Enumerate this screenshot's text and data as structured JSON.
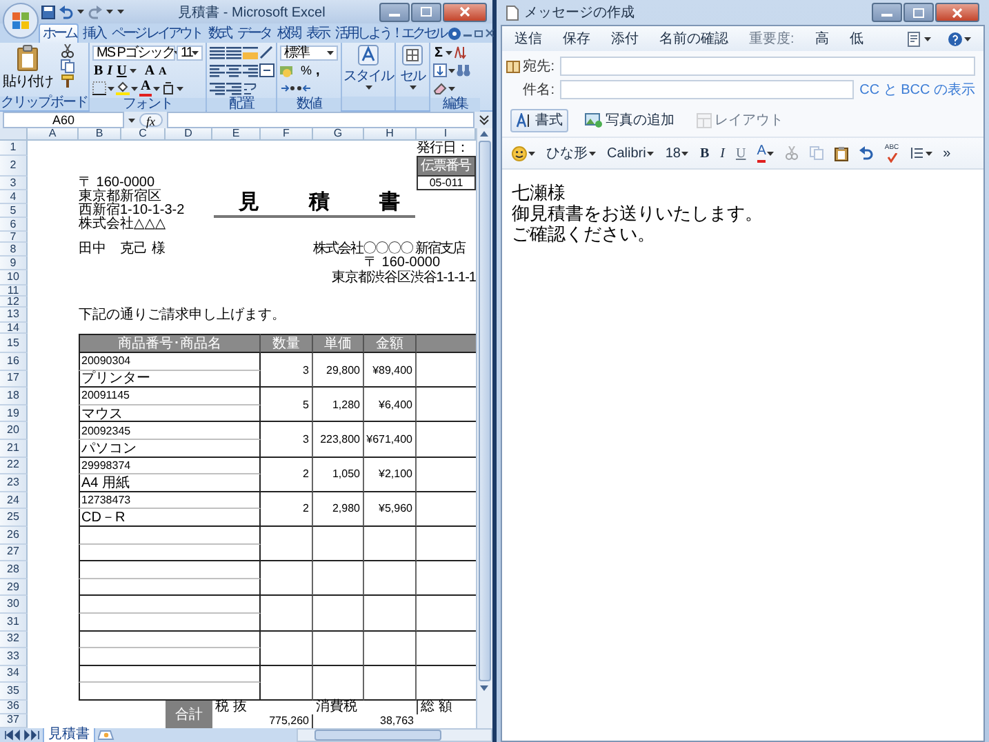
{
  "excel": {
    "title": "見積書 - Microsoft Excel",
    "tabs": [
      {
        "label": "ホーム",
        "selected": true
      },
      {
        "label": "挿入",
        "selected": false
      },
      {
        "label": "ページ レイアウト",
        "selected": false
      },
      {
        "label": "数式",
        "selected": false
      },
      {
        "label": "データ",
        "selected": false
      },
      {
        "label": "校閲",
        "selected": false
      },
      {
        "label": "表示",
        "selected": false
      },
      {
        "label": "活用しよう！エクセル",
        "selected": false
      }
    ],
    "ribbon": {
      "clipboard": {
        "label": "クリップボード",
        "paste": "貼り付け"
      },
      "font": {
        "label": "フォント",
        "font_name": "MS Pゴシック",
        "font_size": "11",
        "grow": "A",
        "shrink": "A",
        "bold": "B",
        "italic": "I",
        "underline": "U",
        "font_color": "A"
      },
      "alignment": {
        "label": "配置"
      },
      "number": {
        "label": "数値",
        "format": "標準",
        "percent": "%",
        "comma": ","
      },
      "styles": {
        "button": "スタイル"
      },
      "cells": {
        "button": "セル"
      },
      "editing": {
        "label": "編集",
        "sum": "Σ"
      }
    },
    "name_box": "A60",
    "fx": "fx",
    "columns": [
      "A",
      "B",
      "C",
      "D",
      "E",
      "F",
      "G",
      "H",
      "I"
    ],
    "rows": [
      "1",
      "2",
      "3",
      "4",
      "5",
      "6",
      "7",
      "8",
      "9",
      "10",
      "11",
      "12",
      "13",
      "14",
      "15",
      "16",
      "17",
      "18",
      "19",
      "20",
      "21",
      "22",
      "23",
      "24",
      "25",
      "26",
      "27",
      "28",
      "29",
      "30",
      "31",
      "32",
      "33",
      "34",
      "35",
      "36",
      "37"
    ],
    "sheet": {
      "issue_date_label": "発行日：",
      "slip_number_label": "伝票番号",
      "slip_number": "05-011",
      "sender": [
        "〒 160-0000",
        "東京都新宿区",
        "西新宿1-10-1-3-2",
        "株式会社△△△"
      ],
      "title": "見積書",
      "recipient": "田中　克己 様",
      "issuer": [
        "株式会社〇〇〇〇 新宿支店",
        "〒 160-0000",
        "東京都渋谷区渋谷1-1-1-1"
      ],
      "intro": "下記の通りご請求申し上げます。",
      "headers": [
        "商品番号･商品名",
        "数量",
        "単価",
        "金額"
      ],
      "items": [
        {
          "code": "20090304",
          "name": "プリンター",
          "qty": "3",
          "unit_price": "29,800",
          "amount": "¥89,400"
        },
        {
          "code": "20091145",
          "name": "マウス",
          "qty": "5",
          "unit_price": "1,280",
          "amount": "¥6,400"
        },
        {
          "code": "20092345",
          "name": "パソコン",
          "qty": "3",
          "unit_price": "223,800",
          "amount": "¥671,400"
        },
        {
          "code": "29998374",
          "name": "A4 用紙",
          "qty": "2",
          "unit_price": "1,050",
          "amount": "¥2,100"
        },
        {
          "code": "12738473",
          "name": "CD－R",
          "qty": "2",
          "unit_price": "2,980",
          "amount": "¥5,960"
        }
      ],
      "total_label": "合計",
      "subtotal_label": "税 抜",
      "subtotal": "775,260",
      "tax_label": "消費税",
      "tax": "38,763",
      "grand_total_label": "総 額"
    },
    "sheet_tabs": [
      {
        "label": "見積書",
        "selected": true
      }
    ]
  },
  "mail": {
    "title": "メッセージの作成",
    "toolbar": [
      {
        "label": "送信",
        "disabled": false
      },
      {
        "label": "保存",
        "disabled": false
      },
      {
        "label": "添付",
        "disabled": false
      },
      {
        "label": "名前の確認",
        "disabled": false
      },
      {
        "label": "重要度:",
        "disabled": true
      },
      {
        "label": "高",
        "disabled": false
      },
      {
        "label": "低",
        "disabled": false
      }
    ],
    "to_label": "宛先:",
    "subject_label": "件名:",
    "cc_bcc_link": "CC と BCC の表示",
    "actions": [
      {
        "kind": "format",
        "label": "書式",
        "selected": true,
        "disabled": false
      },
      {
        "kind": "photo",
        "label": "写真の追加",
        "selected": false,
        "disabled": false
      },
      {
        "kind": "layout",
        "label": "レイアウト",
        "selected": false,
        "disabled": true
      }
    ],
    "format_bar": [
      {
        "kind": "emoji",
        "disabled": false
      },
      {
        "kind": "dropdown",
        "label": "ひな形",
        "disabled": false
      },
      {
        "kind": "dropdown",
        "label": "Calibri",
        "disabled": false
      },
      {
        "kind": "dropdown",
        "label": "18",
        "disabled": false
      },
      {
        "kind": "bold",
        "label": "B",
        "disabled": false
      },
      {
        "kind": "italic",
        "label": "I",
        "disabled": false
      },
      {
        "kind": "underline",
        "label": "U",
        "disabled": true
      },
      {
        "kind": "font-color",
        "label": "A",
        "disabled": false
      },
      {
        "kind": "cut",
        "disabled": true
      },
      {
        "kind": "copy",
        "disabled": true
      },
      {
        "kind": "paste",
        "disabled": false
      },
      {
        "kind": "undo",
        "disabled": false
      },
      {
        "kind": "spellcheck",
        "label": "ABC",
        "disabled": false
      },
      {
        "kind": "list",
        "disabled": false
      },
      {
        "kind": "more",
        "label": "»",
        "disabled": false
      }
    ],
    "body": [
      "七瀬様",
      "御見積書をお送りいたします。",
      "ご確認ください。"
    ]
  }
}
